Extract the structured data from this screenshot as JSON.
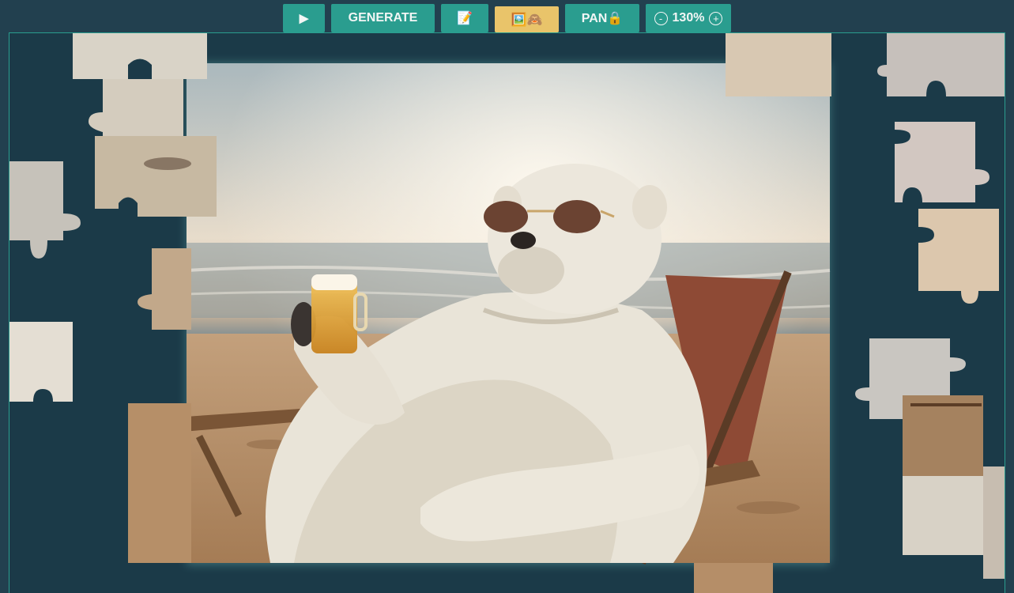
{
  "toolbar": {
    "play_label": "▶",
    "generate_label": "GENERATE",
    "edit_label": "📝",
    "preview_label": "🖼️🙈",
    "pan_label": "PAN🔒",
    "zoom_out_label": "-",
    "zoom_value": "130%",
    "zoom_in_label": "+"
  },
  "puzzle": {
    "image_subject": "polar bear in sunglasses holding a beer on a beach lounge chair",
    "colors": {
      "board_bg": "#1b3a48",
      "page_bg": "#22404f",
      "accent": "#2a9d8f",
      "preview_active": "#e9c46a"
    }
  }
}
